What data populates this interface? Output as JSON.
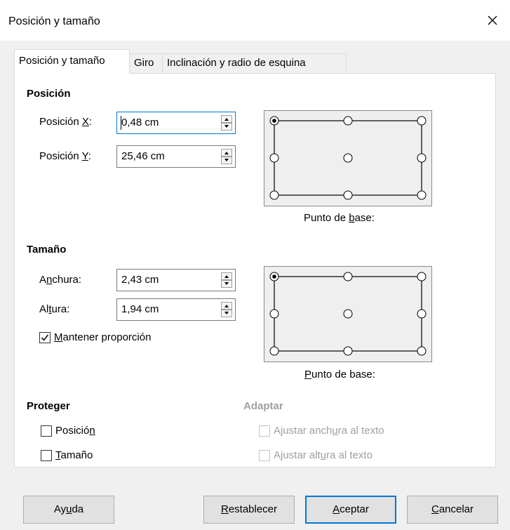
{
  "window": {
    "title": "Posición y tamaño"
  },
  "tabs": [
    {
      "label": "Posición y tamaño",
      "active": true
    },
    {
      "label": "Giro",
      "active": false
    },
    {
      "label": "Inclinación y radio de esquina",
      "active": false
    }
  ],
  "position": {
    "heading": "Posición",
    "x_label_pre": "Posición ",
    "x_label_key": "X",
    "x_label_post": ":",
    "x_value": "0,48 cm",
    "y_label_pre": "Posición ",
    "y_label_key": "Y",
    "y_label_post": ":",
    "y_value": "25,46 cm",
    "base_point_pre": "Punto de ",
    "base_point_key": "b",
    "base_point_post": "ase:"
  },
  "size": {
    "heading": "Tamaño",
    "width_label_pre": "A",
    "width_label_key": "n",
    "width_label_post": "chura:",
    "width_value": "2,43 cm",
    "height_label_pre": "Al",
    "height_label_key": "t",
    "height_label_post": "ura:",
    "height_value": "1,94 cm",
    "keep_ratio_key": "M",
    "keep_ratio_post": "antener proporción",
    "keep_ratio_checked": true,
    "base_point_key": "P",
    "base_point_post": "unto de base:"
  },
  "protect": {
    "heading": "Proteger",
    "position_pre": "Posició",
    "position_key": "n",
    "position_post": "",
    "size_key": "T",
    "size_post": "amaño"
  },
  "adapt": {
    "heading": "Adaptar",
    "fit_width_pre": "Ajustar anch",
    "fit_width_key": "u",
    "fit_width_post": "ra al texto",
    "fit_height_pre": "Ajustar alt",
    "fit_height_key": "u",
    "fit_height_post": "ra al texto"
  },
  "buttons": {
    "help_pre": "Ay",
    "help_key": "u",
    "help_post": "da",
    "reset_key": "R",
    "reset_post": "establecer",
    "ok_key": "A",
    "ok_post": "ceptar",
    "cancel_key": "C",
    "cancel_post": "ancelar"
  },
  "icons": {
    "close": "close-icon",
    "spin_up": "spin-up-icon",
    "spin_down": "spin-down-icon",
    "check": "checkmark-icon"
  },
  "colors": {
    "accent": "#0078d7",
    "disabled": "#a0a0a0",
    "panel": "#ffffff",
    "window": "#f0f0f0"
  }
}
